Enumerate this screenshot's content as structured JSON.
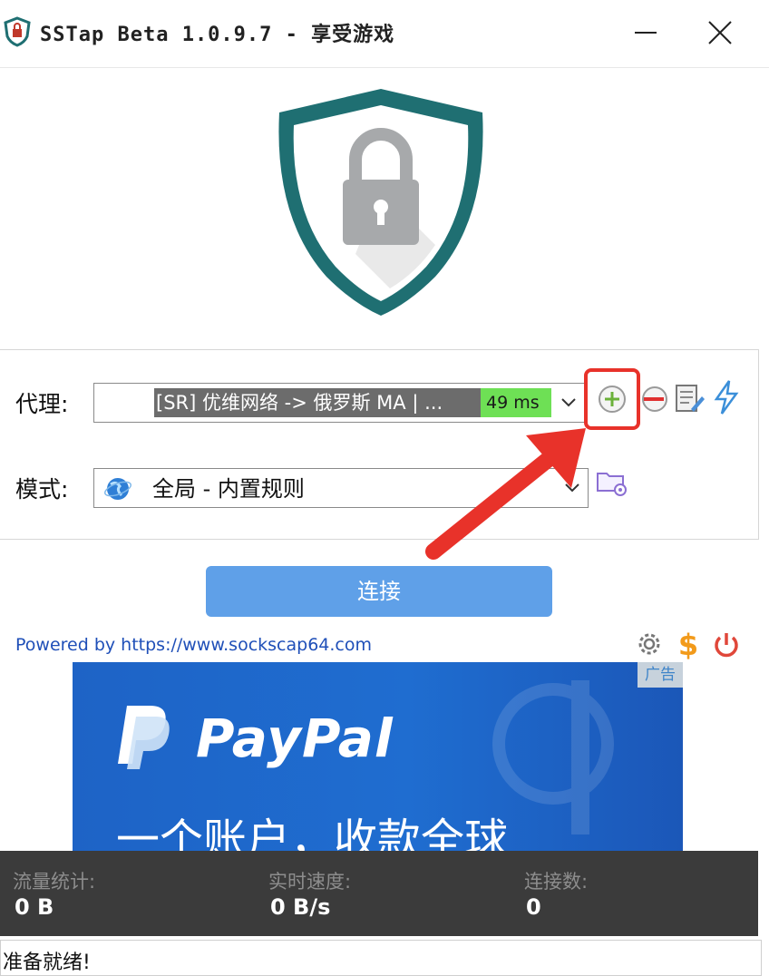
{
  "window": {
    "title": "SSTap Beta 1.0.9.7 - 享受游戏"
  },
  "proxy": {
    "label": "代理:",
    "selected": "[SR] 优维网络 -> 俄罗斯 MA | ...",
    "ping": "49 ms"
  },
  "mode": {
    "label": "模式:",
    "selected": "全局 - 内置规则"
  },
  "connect": {
    "label": "连接"
  },
  "footer": {
    "powered_by": "Powered by https://www.sockscap64.com"
  },
  "ad": {
    "tag": "广告",
    "brand": "PayPal",
    "slogan": "一个账户，收款全球"
  },
  "stats": {
    "traffic_label": "流量统计:",
    "traffic_value": "0 B",
    "speed_label": "实时速度:",
    "speed_value": "0 B/s",
    "connections_label": "连接数:",
    "connections_value": "0"
  },
  "status": {
    "text": "准备就绪!"
  },
  "colors": {
    "shield_teal": "#1f6f72",
    "connect_blue": "#5fa0e8",
    "ping_green": "#6ee055",
    "highlight_red": "#e8322a",
    "stats_bg": "#3b3b3b",
    "paypal_blue": "#1e63c6"
  }
}
